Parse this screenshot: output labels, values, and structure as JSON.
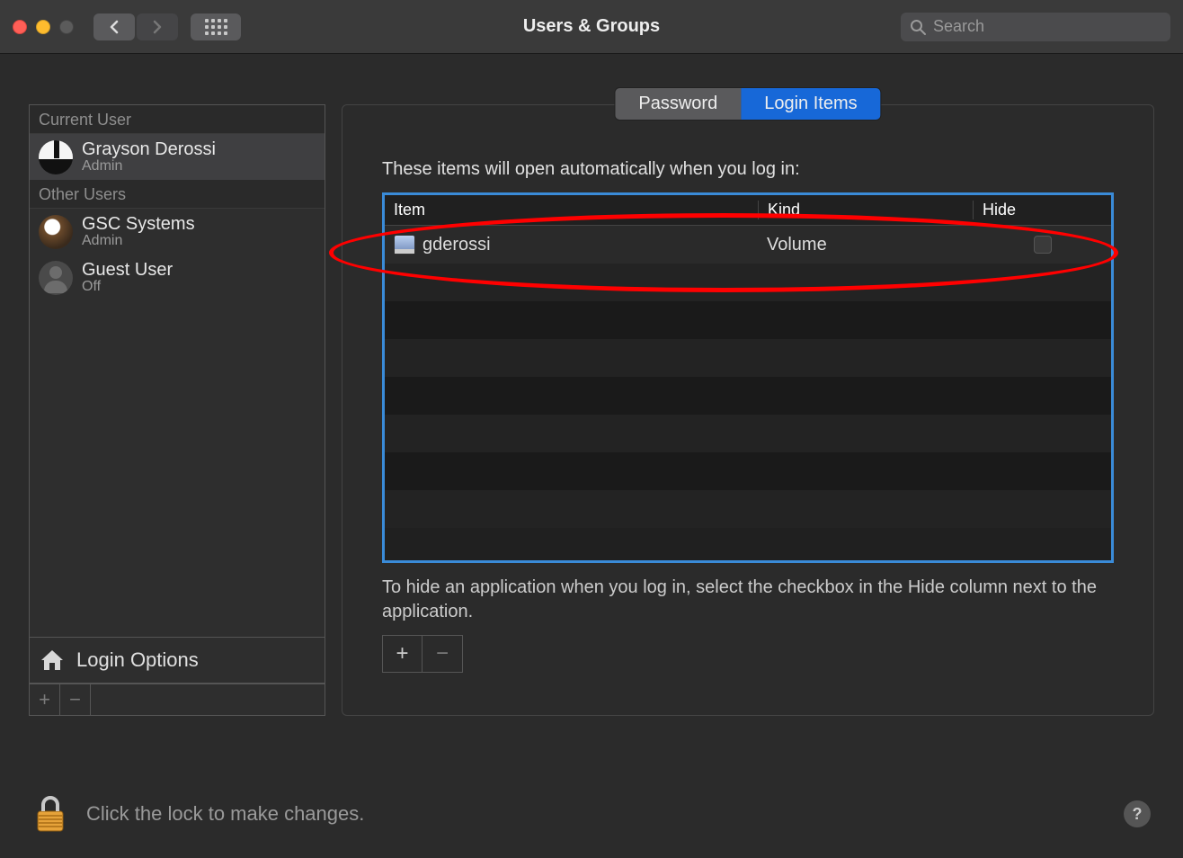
{
  "window": {
    "title": "Users & Groups",
    "search_placeholder": "Search"
  },
  "sidebar": {
    "sections": [
      {
        "title": "Current User",
        "users": [
          {
            "name": "Grayson Derossi",
            "role": "Admin",
            "avatar": "piano",
            "selected": true
          }
        ]
      },
      {
        "title": "Other Users",
        "users": [
          {
            "name": "GSC Systems",
            "role": "Admin",
            "avatar": "eagle",
            "selected": false
          },
          {
            "name": "Guest User",
            "role": "Off",
            "avatar": "silhouette",
            "selected": false
          }
        ]
      }
    ],
    "login_options_label": "Login Options"
  },
  "tabs": [
    {
      "label": "Password",
      "active": false
    },
    {
      "label": "Login Items",
      "active": true
    }
  ],
  "main": {
    "description": "These items will open automatically when you log in:",
    "columns": {
      "item": "Item",
      "kind": "Kind",
      "hide": "Hide"
    },
    "rows": [
      {
        "item": "gderossi",
        "kind": "Volume",
        "hide_checked": false
      }
    ],
    "hint": "To hide an application when you log in, select the checkbox in the Hide column next to the application."
  },
  "footer": {
    "lock_text": "Click the lock to make changes."
  },
  "colors": {
    "accent": "#1768d8",
    "annotation": "#ff0000"
  }
}
